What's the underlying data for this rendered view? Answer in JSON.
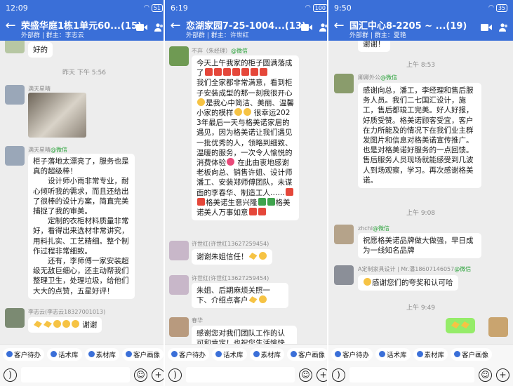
{
  "panels": [
    {
      "status_time": "12:09",
      "status_right": "51",
      "title": "荣盛华庭1栋1单元60...(15)",
      "subtitle": "外部群 | 群主：李志云",
      "timestamps": [
        "昨天 下午 5:56"
      ],
      "messages": [
        {
          "text": "好的"
        },
        {
          "sender": "满天星晴",
          "sender_tag": ""
        },
        {
          "sender": "满天星晴",
          "sender_tag": "@微信",
          "lines": [
            "柜子落地太漂亮了，服务也是真的超级棒！",
            "设计师小雨非常专业，耐心倾听我的需求，而且还给出了很棒的设计方案，简直完美捕捉了我的审美。",
            "定制的衣柜材料质量非常好，看得出来选材非常讲究，用料扎实、工艺精细。整个制作过程非常细致。",
            "还有，李师傅一家安装超级无敌巨细心，还主动帮我们整理卫生，处理垃圾，给他们大大的点赞，五星好评！"
          ]
        },
        {
          "sender": "李志云(李志云18327001013)",
          "text": "谢谢"
        }
      ]
    },
    {
      "status_time": "6:19",
      "status_right": "100",
      "title": "恋湖家园7-25-1004...(13)",
      "subtitle": "外部群 | 群主：许世红",
      "messages": [
        {
          "sender": "不弃（朱经理）",
          "sender_tag": "@微信",
          "lines": [
            "今天上午我家的柜子圆满落成了",
            "我们全家都非常满意，看到柜子安装成型的那一刻我很开心",
            "是我心中简洁、美丽、温馨小家的模样",
            "很幸运2023年最后一天与格美诺家居的遇见，因为格美诺让我们遇见一批优秀的人，领略到细致、温暖的服务，一次令人愉悦的消费体验",
            "在此由衷地感谢老板向总、销售许姐、设计师潘工、安装郑师傅团队，未谋面的李春华、制造工人……",
            "格美诺生意兴隆",
            "格美诺美人万事如意"
          ]
        },
        {
          "sender": "许世红(许世红13627259454)",
          "text": "谢谢朱姐信任！"
        },
        {
          "sender": "许世红(许世红13627259454)",
          "text": "朱姐、后期麻烦关照一下、介绍点客户"
        },
        {
          "sender": "春华",
          "text": "感谢您对我们团队工作的认可和肯定！也祝您生活愉快"
        }
      ]
    },
    {
      "status_time": "9:50",
      "status_right": "35",
      "title": "国汇中心8-2205 ~ ...(19)",
      "subtitle": "外部群 | 群主：夏艳",
      "timestamps": [
        "上午 8:53",
        "上午 9:08",
        "上午 9:49"
      ],
      "messages": [
        {
          "text": "谢谢！"
        },
        {
          "sender": "卿卿外公",
          "sender_tag": "@微信",
          "text": "感谢向总，潘工，李经理和售后服务人员。我们二七国汇设计，施工，售后都竣工完美。好人好报，好质受赞。格美诺顾客受宜，客户在力所能及的情况下在我们业主群发图片和信息对格美诺宣传推广。也是对格美诺好服务的一点回馈。售后服务人员现场就能感受到几波人到场观察，学习。再次感谢格美诺。"
        },
        {
          "sender": "zhchl",
          "sender_tag": "@微信",
          "text": "祝愿格美诺品牌做大做强，早日成为一线知名品牌"
        },
        {
          "sender": "A定制家具设计 | Mr.潘18607146057",
          "sender_tag": "@微信",
          "text": "感谢您们的夸奖和认可哈"
        }
      ]
    }
  ],
  "toolbar": {
    "items": [
      "客户待办",
      "话术库",
      "素材库",
      "客户画像"
    ]
  },
  "colors": {
    "header": "#3a6fd8",
    "chat_bg": "#ededed",
    "bubble_self": "#95ec69",
    "wechat_tag": "#2aa23a"
  }
}
